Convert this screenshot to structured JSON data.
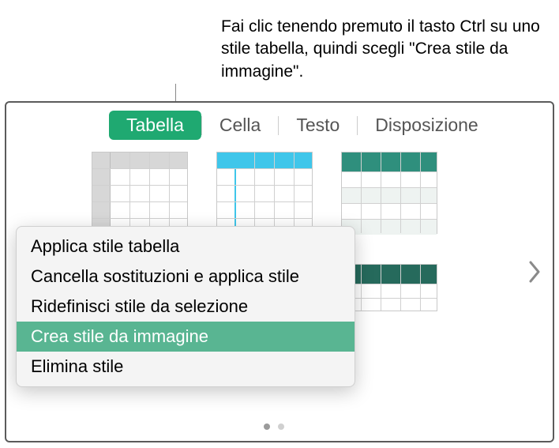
{
  "callout": {
    "text": "Fai clic tenendo premuto il tasto Ctrl su uno stile tabella, quindi scegli \"Crea stile da immagine\"."
  },
  "tabs": {
    "items": [
      {
        "label": "Tabella",
        "active": true
      },
      {
        "label": "Cella",
        "active": false
      },
      {
        "label": "Testo",
        "active": false
      },
      {
        "label": "Disposizione",
        "active": false
      }
    ]
  },
  "context_menu": {
    "items": [
      {
        "label": "Applica stile tabella",
        "highlighted": false
      },
      {
        "label": "Cancella sostituzioni e applica stile",
        "highlighted": false
      },
      {
        "label": "Ridefinisci stile da selezione",
        "highlighted": false
      },
      {
        "label": "Crea stile da immagine",
        "highlighted": true
      },
      {
        "label": "Elimina stile",
        "highlighted": false
      }
    ]
  },
  "gallery": {
    "styles": [
      {
        "name": "table-style-gray-header"
      },
      {
        "name": "table-style-cyan-header"
      },
      {
        "name": "table-style-teal-banded"
      }
    ],
    "page_count": 2,
    "active_page": 0
  }
}
